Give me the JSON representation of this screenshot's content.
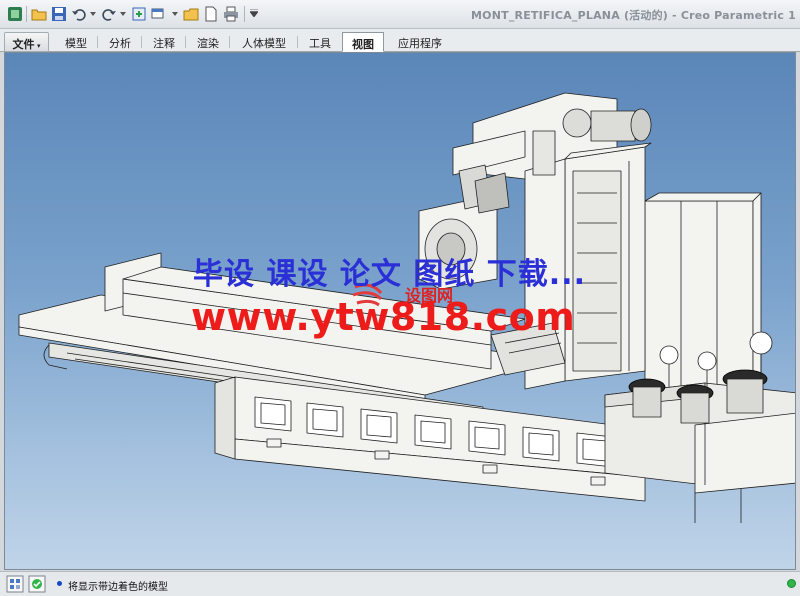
{
  "window": {
    "title": "MONT_RETIFICA_PLANA (活动的) - Creo Parametric 1"
  },
  "quick_access": {
    "icons": [
      "app-icon",
      "open-icon",
      "save-icon",
      "undo-icon",
      "redo-icon",
      "regenerate-icon",
      "window-switch-icon",
      "new-folder-icon",
      "new-file-icon",
      "print-icon",
      "customize-icon"
    ]
  },
  "ribbon": {
    "tabs": [
      {
        "label": "文件",
        "kind": "file"
      },
      {
        "label": "模型"
      },
      {
        "label": "分析"
      },
      {
        "label": "注释"
      },
      {
        "label": "渲染"
      },
      {
        "label": "人体模型"
      },
      {
        "label": "工具"
      },
      {
        "label": "视图",
        "active": true
      },
      {
        "label": "应用程序"
      }
    ]
  },
  "watermark": {
    "line1": "毕设 课设 论文 图纸 下载...",
    "line2": "www.ytw818.com",
    "logo_text": "设图网",
    "colors": {
      "line1": "#2a2fd6",
      "line2": "#ee1b1b"
    }
  },
  "statusbar": {
    "message": "将显示带边着色的模型",
    "icons": [
      "selection-filter-icon",
      "smart-select-icon"
    ],
    "status_color": "#2fb54a"
  },
  "colors": {
    "viewport_top": "#5a86b8",
    "viewport_bottom": "#c0d4e8",
    "model_fill": "#f3f3f0",
    "model_edge": "#202020"
  }
}
